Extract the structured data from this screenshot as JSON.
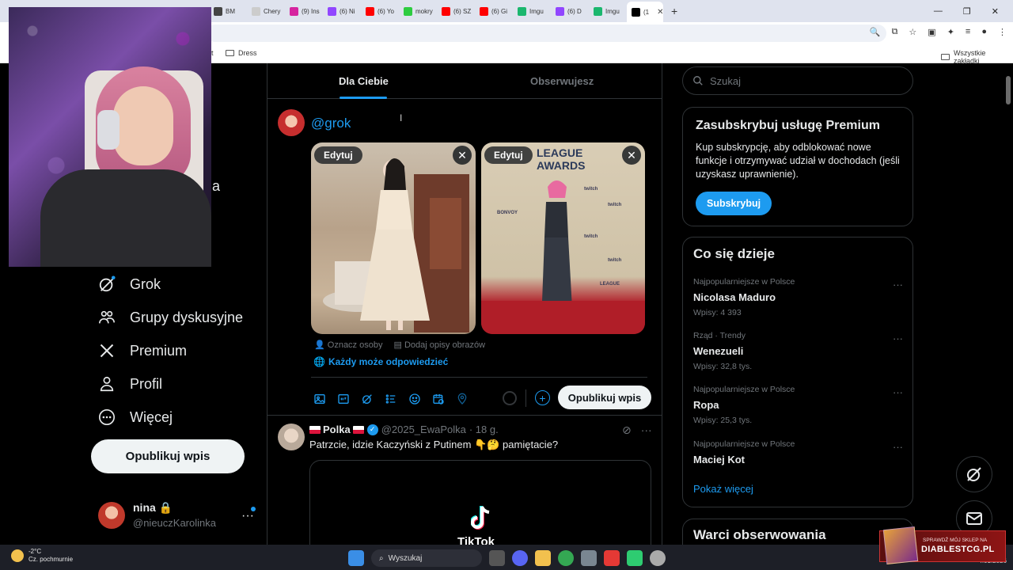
{
  "browser": {
    "tabs": [
      {
        "label": "",
        "color": "#e24a33"
      },
      {
        "label": "",
        "color": "#444444"
      },
      {
        "label": "",
        "color": "#1877f2"
      },
      {
        "label": "",
        "color": "#555555"
      },
      {
        "label": "",
        "color": "#e53935"
      },
      {
        "label": "",
        "color": "#888888"
      },
      {
        "label": "",
        "color": "#8f8fb8"
      },
      {
        "label": "",
        "color": "#999999"
      },
      {
        "label": "BM",
        "color": "#444444"
      },
      {
        "label": "Chery",
        "color": "#cccccc"
      },
      {
        "label": "(9) Ins",
        "color": "#d6249f"
      },
      {
        "label": "(6) Ni",
        "color": "#9146ff"
      },
      {
        "label": "(6) Yo",
        "color": "#ff0000"
      },
      {
        "label": "mokry",
        "color": "#2ecc40"
      },
      {
        "label": "(6) SZ",
        "color": "#ff0000"
      },
      {
        "label": "(6) Gi",
        "color": "#ff0000"
      },
      {
        "label": "Imgu",
        "color": "#1bb76e"
      },
      {
        "label": "(6) D",
        "color": "#9146ff"
      },
      {
        "label": "Imgu",
        "color": "#1bb76e"
      },
      {
        "label": "(1",
        "color": "#000000"
      }
    ],
    "bookmarks": {
      "partial": "at",
      "folder": "Dress",
      "all": "Wszystkie zakładki"
    }
  },
  "nav": {
    "partial_label": "ia",
    "items": [
      {
        "label": "Grok",
        "icon": "grok-icon"
      },
      {
        "label": "Grupy dyskusyjne",
        "icon": "communities-icon"
      },
      {
        "label": "Premium",
        "icon": "x-logo-icon"
      },
      {
        "label": "Profil",
        "icon": "profile-icon"
      },
      {
        "label": "Więcej",
        "icon": "more-circle-icon"
      }
    ],
    "post_button": "Opublikuj wpis",
    "account": {
      "name": "nina",
      "handle": "@nieuczKarolinka"
    }
  },
  "feed": {
    "tabs": [
      {
        "label": "Dla Ciebie",
        "active": true
      },
      {
        "label": "Obserwujesz",
        "active": false
      }
    ],
    "composer": {
      "text": "@grok",
      "edit_label": "Edytuj",
      "media_meta": [
        "Oznacz osoby",
        "Dodaj opisy obrazów"
      ],
      "reply_setting": "Każdy może odpowiedzieć",
      "post_button": "Opublikuj wpis"
    },
    "tweet": {
      "name": "Polka",
      "handle": "@2025_EwaPolka",
      "time": "· 18 g.",
      "text": "Patrzcie,  idzie Kaczyński z Putinem 👇🤔 pamiętacie?",
      "video_brand": "TikTok"
    }
  },
  "sidebar": {
    "search_placeholder": "Szukaj",
    "premium": {
      "title": "Zasubskrybuj usługę Premium",
      "text": "Kup subskrypcję, aby odblokować nowe funkcje i otrzymywać udział w dochodach (jeśli uzyskasz uprawnienie).",
      "button": "Subskrybuj"
    },
    "trends_title": "Co się dzieje",
    "trends": [
      {
        "context": "Najpopularniejsze w Polsce",
        "topic": "Nicolasa Maduro",
        "count": "Wpisy: 4 393"
      },
      {
        "context": "Rząd · Trendy",
        "topic": "Wenezueli",
        "count": "Wpisy: 32,8 tys."
      },
      {
        "context": "Najpopularniejsze w Polsce",
        "topic": "Ropa",
        "count": "Wpisy: 25,3 tys."
      },
      {
        "context": "Najpopularniejsze w Polsce",
        "topic": "Maciej Kot",
        "count": ""
      }
    ],
    "show_more": "Pokaż więcej",
    "follow_title": "Warci obserwowania"
  },
  "taskbar": {
    "temp": "-2°C",
    "weather": "Cz. pochmurnie",
    "search": "Wyszukaj",
    "clock": "4.01.2026"
  },
  "banner": {
    "small": "SPRAWDŹ MÓJ SKLEP NA",
    "big": "DIABLESTCG.PL"
  }
}
